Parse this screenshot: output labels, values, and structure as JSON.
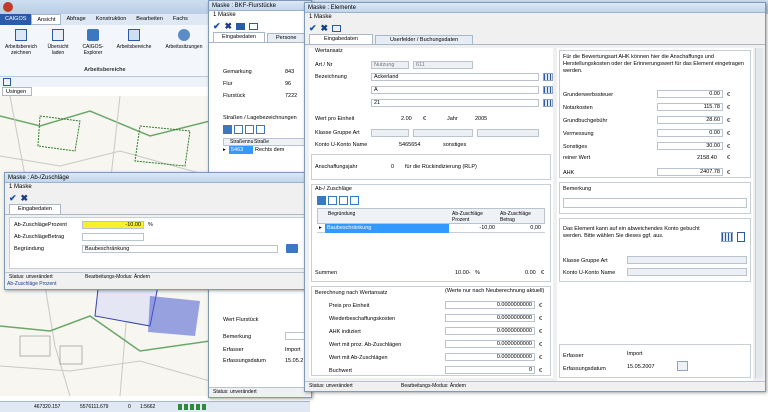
{
  "app": {
    "ribbon_tabs": [
      "CAIGOS",
      "Ansicht",
      "Abfrage",
      "Konstruktion",
      "Bearbeiten",
      "Fachs"
    ],
    "ribbon_buttons": [
      {
        "label": "Arbeitsbereich\nzeichnen"
      },
      {
        "label": "Übersicht\nladen"
      },
      {
        "label": "CAIGOS-\nExplorer"
      },
      {
        "label": "Arbeitsbereiche"
      },
      {
        "label": "Arbeitssitzungen"
      }
    ],
    "ribbon_group_label": "Arbeitsbereiche",
    "map_tab": "Usingen",
    "statusbar": {
      "x": "467320.157",
      "y": "5576111.679",
      "zero": "0",
      "scale": "1:5662"
    }
  },
  "bkf": {
    "title": "Maske : BKF-Flurstücke",
    "menu": "1 Maske",
    "tabs": [
      "Eingabedaten",
      "Persone"
    ],
    "rows": [
      {
        "label": "Gemarkung",
        "value": "843"
      },
      {
        "label": "Flur",
        "value": "96"
      },
      {
        "label": "Flurstück",
        "value": "7222"
      }
    ],
    "section": "Straßen / Lagebezeichnungen",
    "grid_headers": [
      "Straßennu",
      "Straße"
    ],
    "grid_row": {
      "nr": "5463",
      "name": "Rechts dem"
    },
    "bottom_rows": [
      {
        "label": "Wert Flurstück",
        "value": ""
      },
      {
        "label": "Bemerkung",
        "value": ""
      },
      {
        "label": "Erfasser",
        "value": "Import"
      },
      {
        "label": "Erfassungsdatum",
        "value": "15.05.2"
      }
    ],
    "status": "Status: unverändert"
  },
  "abzu": {
    "title": "Maske : Ab-/Zuschläge",
    "menu": "1 Maske",
    "tab": "Eingabedaten",
    "prozent_label": "Ab-ZuschlägeProzent",
    "prozent_value": "-10.00",
    "prozent_unit": "%",
    "betrag_label": "Ab-ZuschlägeBetrag",
    "betrag_value": "",
    "begruendung_label": "Begründung",
    "begruendung_value": "Baubeschränkung",
    "status": "Status: unverändert",
    "modus": "Bearbeitungs-Modus: Ändern",
    "caption": "Ab-Zuschläge Prozent"
  },
  "elemente": {
    "title": "Maske : Elemente",
    "menu": "1 Maske",
    "tabs": [
      "Eingabedaten",
      "Userfelder / Buchungsdaten"
    ],
    "wertansatz": "Wertansatz",
    "artnr_label": "Art / Nr",
    "art_value": "Nutzung",
    "nr_value": "611",
    "bezeichnung_label": "Bezeichnung",
    "bez_lines": [
      "Ackerland",
      "A",
      "21"
    ],
    "wert_label": "Wert pro Einheit",
    "wert_value": "2.00",
    "wert_unit": "€",
    "jahr_label": "Jahr",
    "jahr_value": "2005",
    "klasse_label": "Klasse  Gruppe Art",
    "konto_label": "Konto  U-Konto Name",
    "konto_value": "5465654",
    "konto_name": "sonstiges",
    "anschaffung_label": "Anschaffungsjahr",
    "anschaffung_value": "0",
    "anschaffung_note": "für die Rückindizierung (RLP)",
    "abzu_section": "Ab-/ Zuschläge",
    "abzu_headers": [
      "Begründung",
      "Ab-Zuschläge Prozent",
      "Ab-Zuschläge Betrag"
    ],
    "abzu_row": {
      "begruendung": "Baubeschränkung",
      "prozent": "-10,00",
      "betrag": "0,00"
    },
    "summen_label": "Summen",
    "summen_prozent": "10.00-",
    "summen_unit": "%",
    "summen_betrag": "0.00",
    "summen_betrag_unit": "€",
    "berechnung_label": "Berechnung nach Wertansatz",
    "berechnung_note": "(Werte nur nach Neuberechnung aktuell)",
    "berechnung_rows": [
      {
        "label": "Preis pro Einheit",
        "value": "0.0000000000",
        "unit": "€"
      },
      {
        "label": "Wiederbeschaffungskosten",
        "value": "0.0000000000",
        "unit": "€"
      },
      {
        "label": "AHK indiziert",
        "value": "0.0000000000",
        "unit": "€"
      },
      {
        "label": "Wert mit proz. Ab-Zuschlägen",
        "value": "0.0000000000",
        "unit": "€"
      },
      {
        "label": "Wert mit Ab-Zuschlägen",
        "value": "0.0000000000",
        "unit": "€"
      },
      {
        "label": "Buchwert",
        "value": "0",
        "unit": "€"
      }
    ],
    "info_text": "Für die Bewertungsart AHK können hier die Anschaffungs und Herstellungskosten oder der Erinnerungswert für das Element eingetragen werden.",
    "kosten_rows": [
      {
        "label": "Grunderwerbssteuer",
        "value": "0.00",
        "unit": "€"
      },
      {
        "label": "Notarkosten",
        "value": "115.78",
        "unit": "€"
      },
      {
        "label": "Grundbuchgebühr",
        "value": "28.60",
        "unit": "€"
      },
      {
        "label": "Vermessung",
        "value": "0.00",
        "unit": "€"
      },
      {
        "label": "Sonstiges",
        "value": "30.00",
        "unit": "€"
      },
      {
        "label": "reiner Wert",
        "value": "2158.40",
        "unit": "€"
      }
    ],
    "ahk_label": "AHK",
    "ahk_value": "2407.78",
    "ahk_unit": "€",
    "bemerkung_label": "Bemerkung",
    "konto_info": "Das Element kann auf ein abweichendes Konto gebucht werden. Bitte wählen Sie dieses ggf. aus.",
    "klasse_gruppe_label": "Klasse Gruppe Art",
    "konto_uname_label": "Konto U-Konto Name",
    "erfasser_label": "Erfasser",
    "erfasser_value": "Import",
    "datum_label": "Erfassungsdatum",
    "datum_value": "15.05.2007",
    "status": "Status: unverändert",
    "modus": "Bearbeitungs-Modus: Ändern"
  },
  "colors": {
    "accent": "#1a4fa8",
    "highlight": "#f7f02a",
    "selection": "#3399ff"
  }
}
